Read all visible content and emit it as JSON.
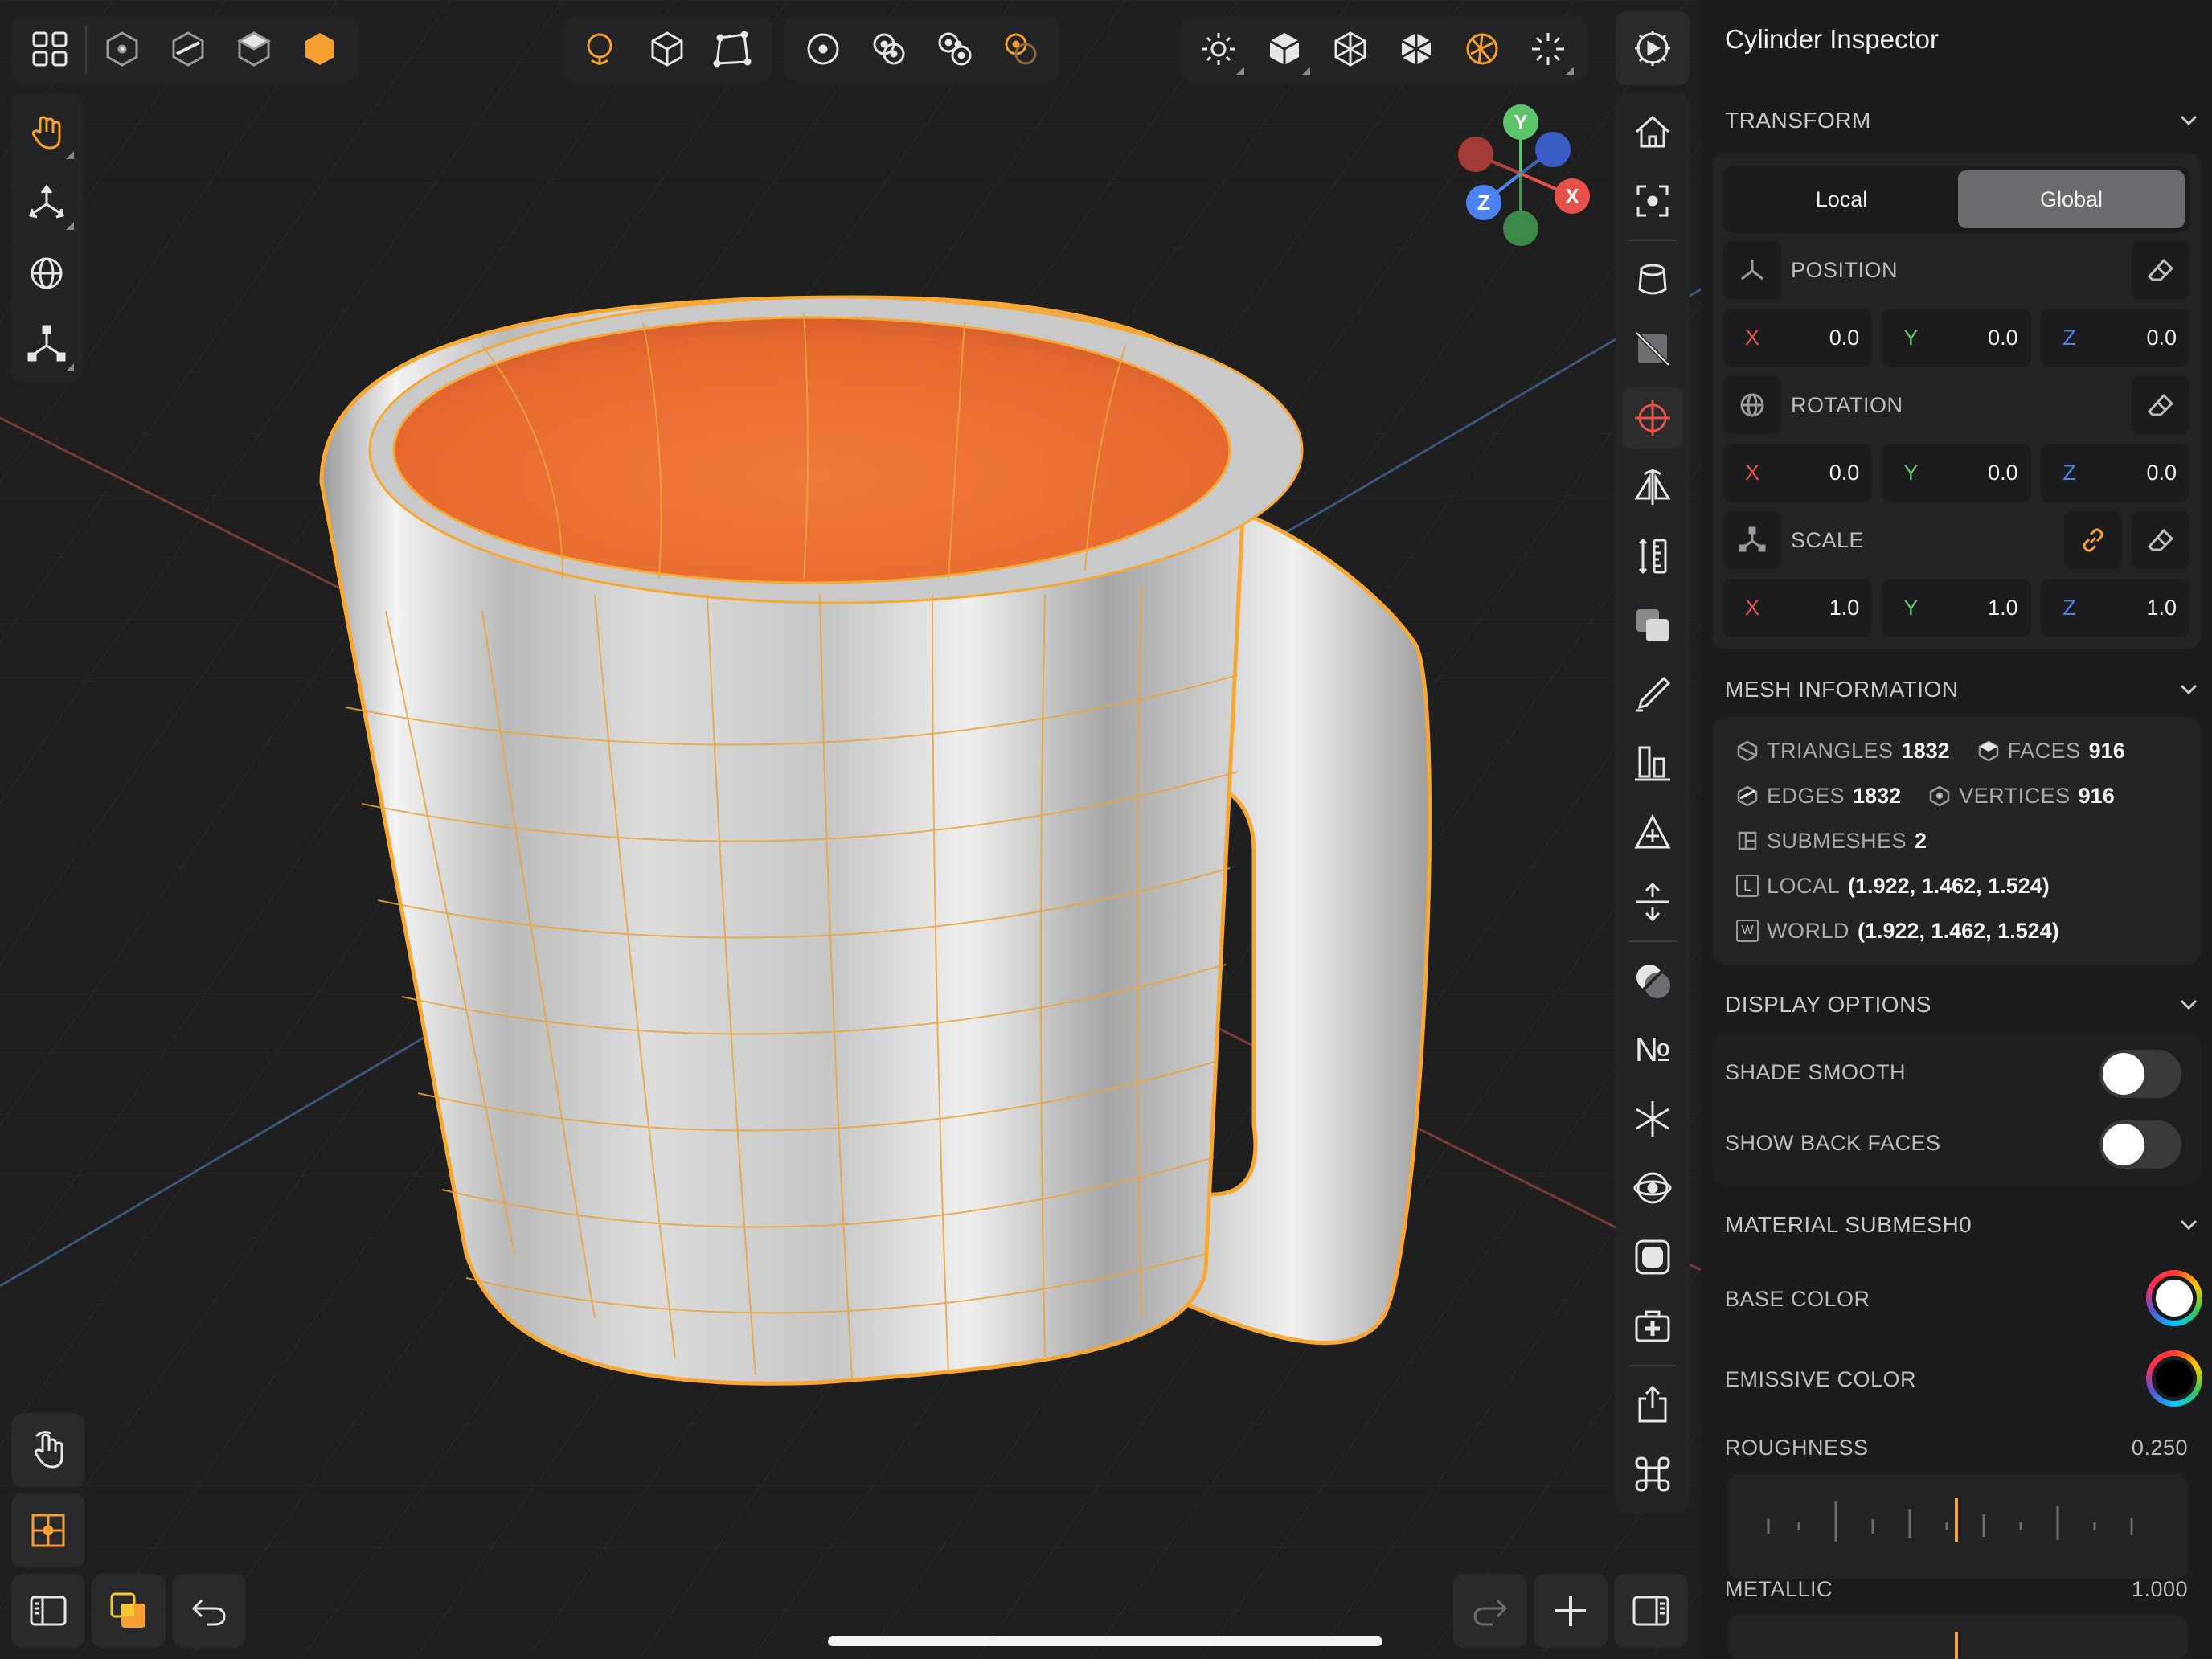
{
  "inspector": {
    "title": "Cylinder Inspector",
    "transform": {
      "header": "TRANSFORM",
      "space_options": [
        "Local",
        "Global"
      ],
      "active_space": "Global",
      "position": {
        "label": "POSITION",
        "x": "0.0",
        "y": "0.0",
        "z": "0.0"
      },
      "rotation": {
        "label": "ROTATION",
        "x": "0.0",
        "y": "0.0",
        "z": "0.0"
      },
      "scale": {
        "label": "SCALE",
        "x": "1.0",
        "y": "1.0",
        "z": "1.0"
      },
      "axis_labels": {
        "x": "X",
        "y": "Y",
        "z": "Z"
      }
    },
    "mesh_info": {
      "header": "MESH INFORMATION",
      "triangles_label": "TRIANGLES",
      "triangles": "1832",
      "faces_label": "FACES",
      "faces": "916",
      "edges_label": "EDGES",
      "edges": "1832",
      "vertices_label": "VERTICES",
      "vertices": "916",
      "submeshes_label": "SUBMESHES",
      "submeshes": "2",
      "local_label": "LOCAL",
      "local": "(1.922, 1.462, 1.524)",
      "world_label": "WORLD",
      "world": "(1.922, 1.462, 1.524)",
      "local_badge": "L",
      "world_badge": "W"
    },
    "display_options": {
      "header": "DISPLAY OPTIONS",
      "shade_smooth": {
        "label": "SHADE SMOOTH",
        "on": false
      },
      "show_back_faces": {
        "label": "SHOW BACK FACES",
        "on": false
      }
    },
    "material": {
      "header": "MATERIAL  SUBMESH0",
      "base_color": {
        "label": "BASE COLOR",
        "value": "#ffffff"
      },
      "emissive_color": {
        "label": "EMISSIVE COLOR",
        "value": "#000000"
      },
      "roughness": {
        "label": "ROUGHNESS",
        "value": "0.250"
      },
      "metallic": {
        "label": "METALLIC",
        "value": "1.000"
      }
    }
  },
  "gizmo": {
    "y": "Y",
    "x": "X",
    "z": "Z"
  },
  "toolbar": {
    "number_tool_glyph": "№"
  },
  "colors": {
    "accent": "#f5a030",
    "selection_outline": "#f7a832",
    "axis_x": "#e8504a",
    "axis_y": "#5dc46a",
    "axis_z": "#4b82f0",
    "panel_bg": "#1c1c1e",
    "card_bg": "#242426"
  },
  "icons": {
    "top_left": [
      "grid-icon",
      "vertex-cube-icon",
      "edge-cube-icon",
      "face-cube-icon",
      "object-hex-icon"
    ],
    "top_center": [
      "globe-pivot-icon",
      "cube-icon",
      "polygon-icon",
      "single-origin-icon",
      "pair-origin-icon",
      "triple-origin-icon",
      "orange-origin-icon"
    ],
    "top_right": [
      "sun-icon",
      "solid-cube-icon",
      "wire-cube-icon",
      "shaded-cube-icon",
      "material-sphere-icon",
      "sparkle-icon",
      "settings-icon"
    ],
    "left_tools": [
      "hand-tool-icon",
      "move-axes-icon",
      "rotate-globe-icon",
      "scale-axes-icon"
    ],
    "right_tools": [
      "home-icon",
      "focus-icon",
      "cylinder-icon",
      "hide-icon",
      "snap-target-icon",
      "mirror-icon",
      "ruler-icon",
      "duplicate-icon",
      "knife-icon",
      "align-icon",
      "triangle-add-icon",
      "extrude-icon",
      "shading-icon",
      "number-icon",
      "star-axes-icon",
      "orbit-eye-icon",
      "rounded-square-icon",
      "medkit-icon",
      "share-icon",
      "command-icon"
    ]
  }
}
